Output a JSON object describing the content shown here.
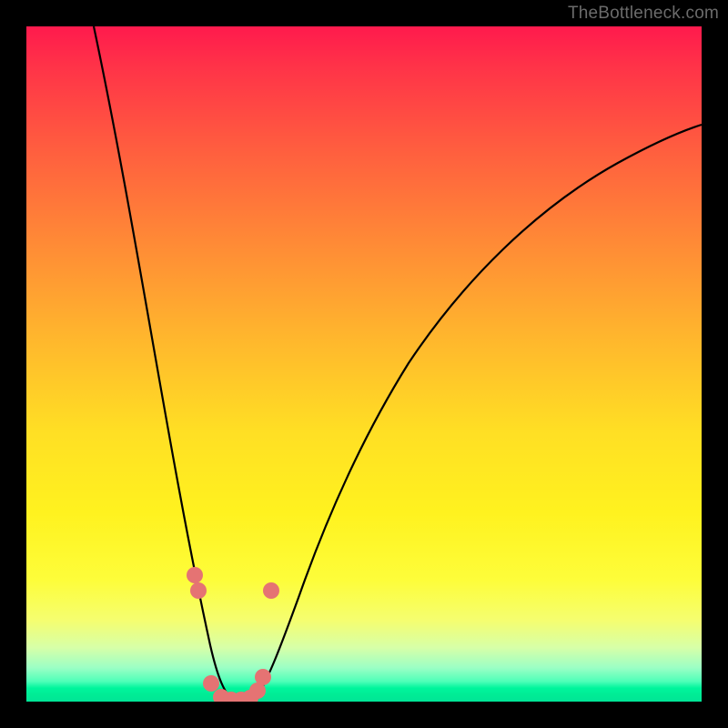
{
  "watermark": "TheBottleneck.com",
  "chart_data": {
    "type": "line",
    "title": "",
    "xlabel": "",
    "ylabel": "",
    "xlim": [
      0,
      100
    ],
    "ylim": [
      0,
      100
    ],
    "grid": false,
    "legend": false,
    "annotations": [],
    "series": [
      {
        "name": "curve",
        "color": "#000000",
        "x": [
          10,
          12,
          14,
          16,
          18,
          20,
          22,
          24,
          25,
          26,
          27,
          28,
          29,
          30,
          31,
          32,
          33,
          34,
          36,
          38,
          42,
          46,
          50,
          55,
          60,
          65,
          70,
          75,
          80,
          85,
          90,
          95,
          100
        ],
        "y": [
          100,
          91,
          82,
          73,
          64,
          54,
          44,
          33,
          27,
          20,
          14,
          8,
          4,
          1,
          0,
          0,
          1,
          3,
          7,
          12,
          21,
          29,
          36,
          44,
          50,
          56,
          61,
          66,
          70,
          74,
          77.5,
          80.5,
          83
        ]
      },
      {
        "name": "markers",
        "color": "#e57373",
        "type": "scatter",
        "x": [
          24.8,
          25.2,
          27.0,
          28.5,
          30.0,
          31.2,
          32.2,
          33.2,
          34.0,
          35.2
        ],
        "y": [
          19,
          17,
          3,
          0.5,
          0,
          0,
          0.5,
          2,
          4,
          17
        ]
      }
    ],
    "background_gradient": {
      "top": "#ff1a4d",
      "mid": "#ffdf24",
      "bottom": "#00e596"
    }
  }
}
